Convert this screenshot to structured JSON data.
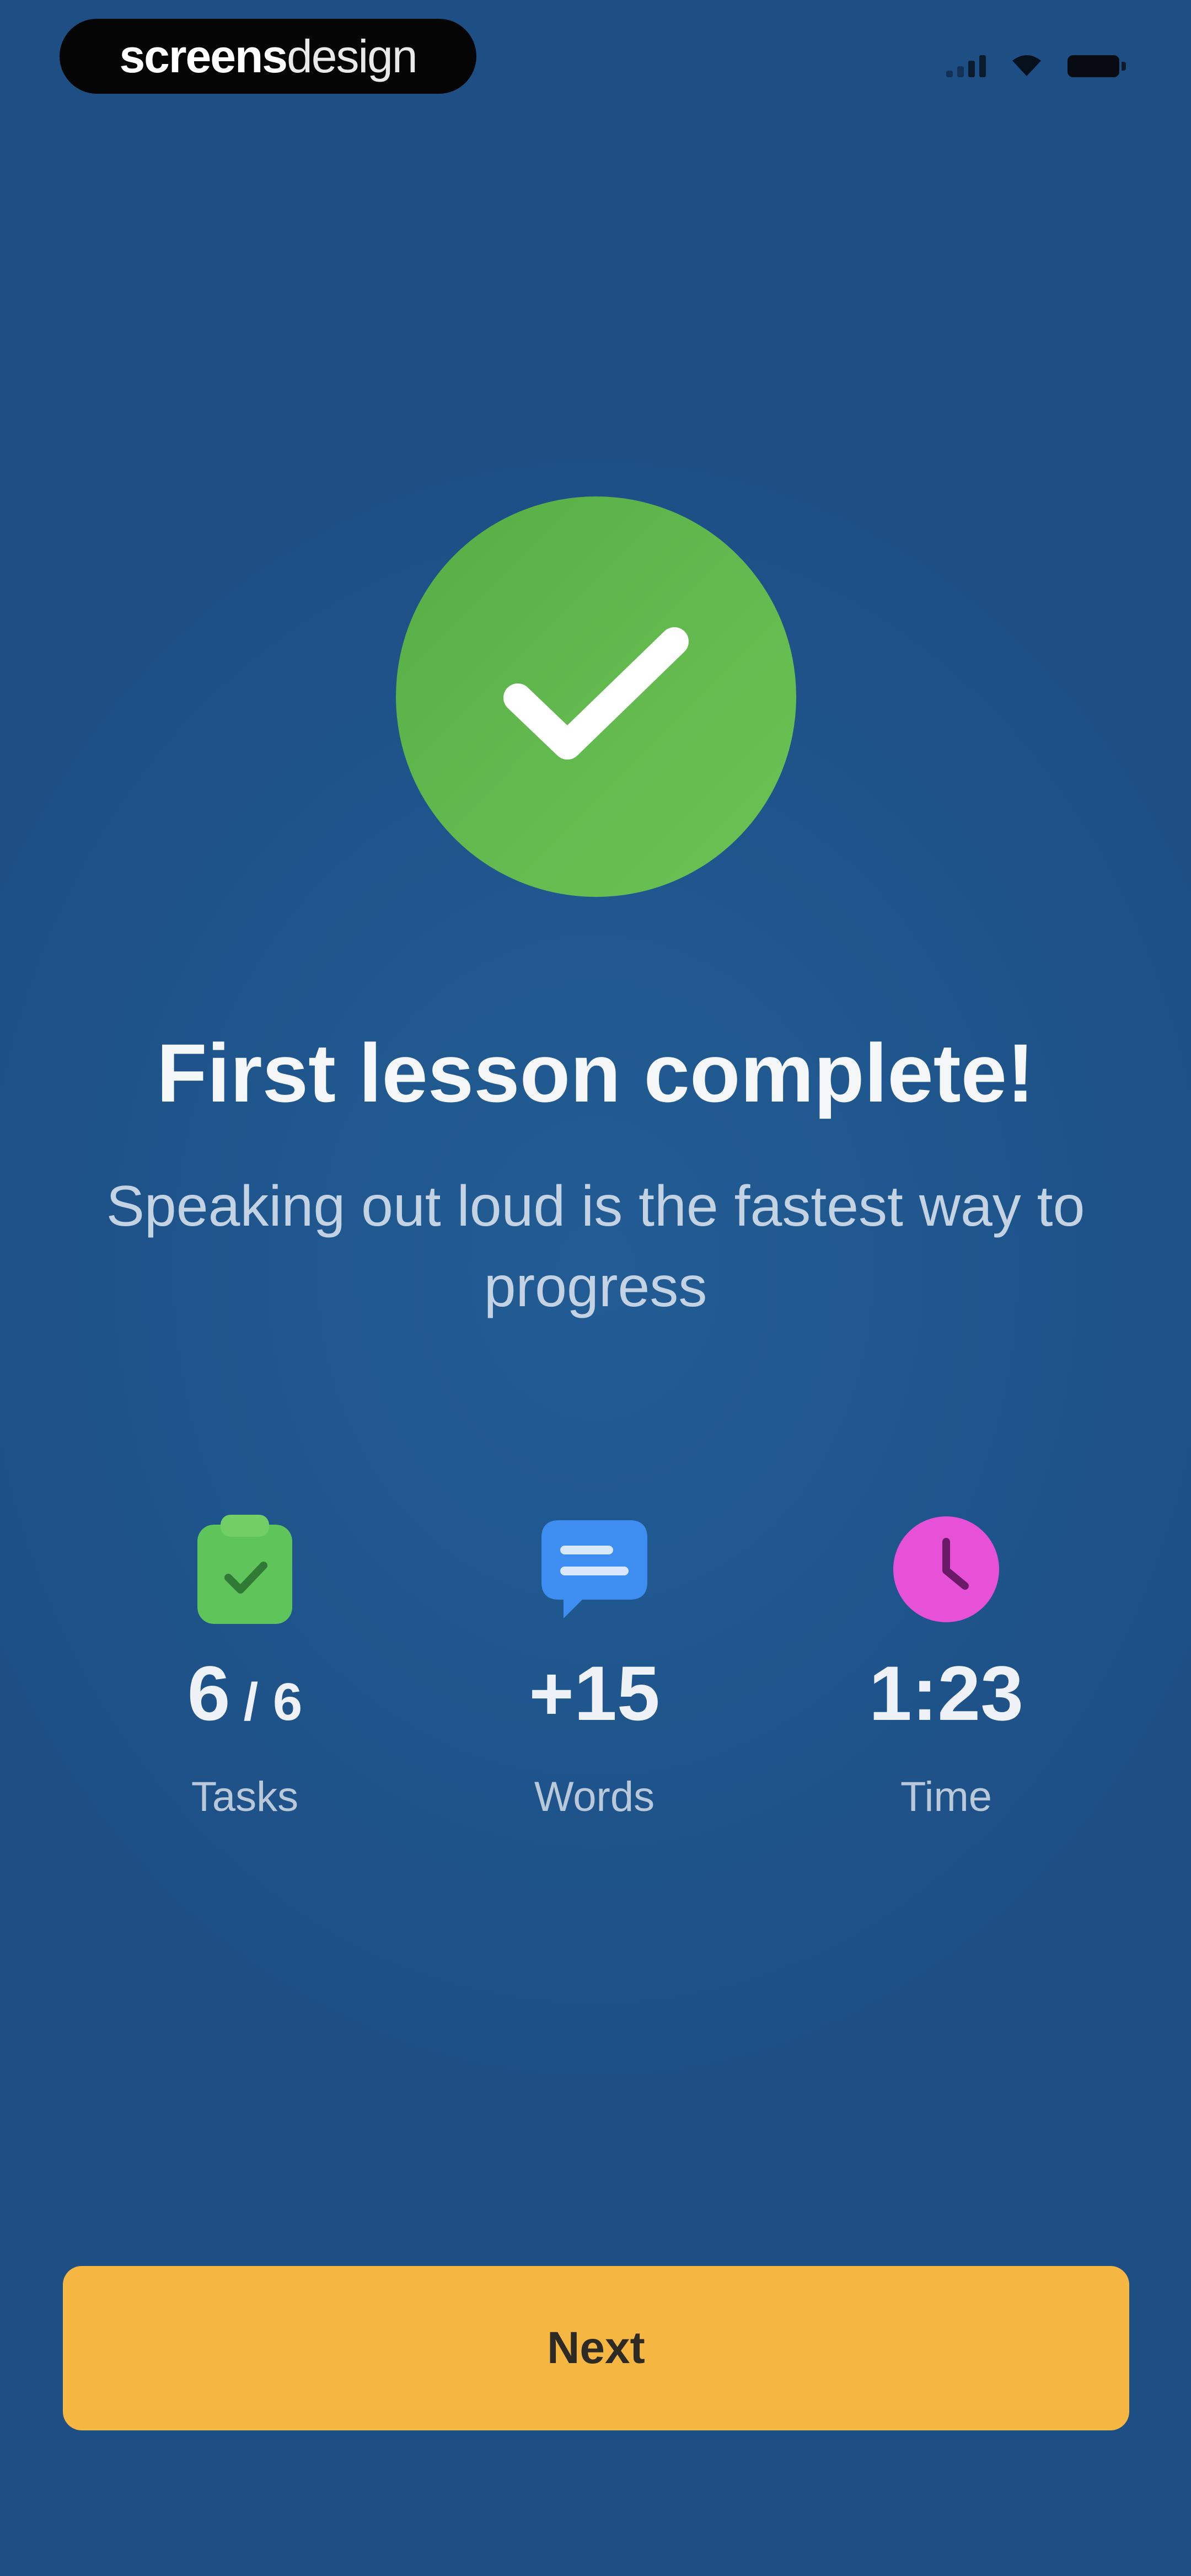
{
  "status_bar": {
    "brand_bold": "screens",
    "brand_light": "design",
    "signal_icon": "cellular-signal-icon",
    "wifi_icon": "wifi-icon",
    "battery_icon": "battery-icon"
  },
  "badge": {
    "icon": "checkmark-icon",
    "color": "#5fb74b"
  },
  "title": "First lesson complete!",
  "subtitle": "Speaking out loud is the fastest way to progress",
  "stats": {
    "tasks": {
      "icon": "clipboard-check-icon",
      "color": "#5fc45a",
      "value": "6",
      "total": "/ 6",
      "label": "Tasks"
    },
    "words": {
      "icon": "chat-bubble-icon",
      "color": "#3d8ef0",
      "value": "+15",
      "label": "Words"
    },
    "time": {
      "icon": "clock-icon",
      "color": "#e651d8",
      "value": "1:23",
      "label": "Time"
    }
  },
  "next_button": {
    "label": "Next",
    "color": "#f5b741"
  }
}
